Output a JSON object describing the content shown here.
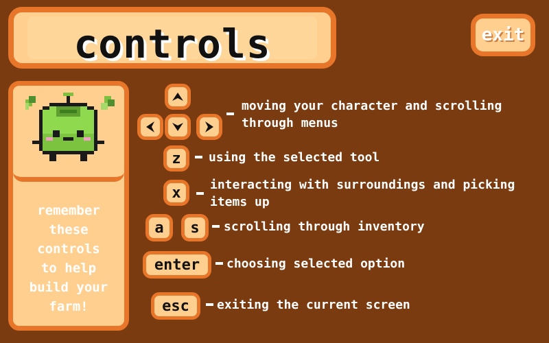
{
  "title": "controls",
  "exit_label": "exit",
  "side": {
    "remember_text": "remember\nthese\ncontrols\nto help\nbuild your\nfarm!"
  },
  "keys": {
    "z": "z",
    "x": "x",
    "a": "a",
    "s": "s",
    "enter": "enter",
    "esc": "esc"
  },
  "descriptions": {
    "arrows_line1": "moving your character and scrolling",
    "arrows_line2": "through menus",
    "z": "using the selected tool",
    "x_line1": "interacting with surroundings and picking",
    "x_line2": "items up",
    "as": "scrolling through inventory",
    "enter": "choosing selected option",
    "esc": "exiting the current screen"
  },
  "icons": {
    "up": "arrow-up-icon",
    "down": "arrow-down-icon",
    "left": "arrow-left-icon",
    "right": "arrow-right-icon",
    "character": "green-apple-character-icon"
  },
  "colors": {
    "background": "#7a3b10",
    "panel": "#ffcf8f",
    "border": "#e8762a",
    "text": "#ffffff"
  }
}
